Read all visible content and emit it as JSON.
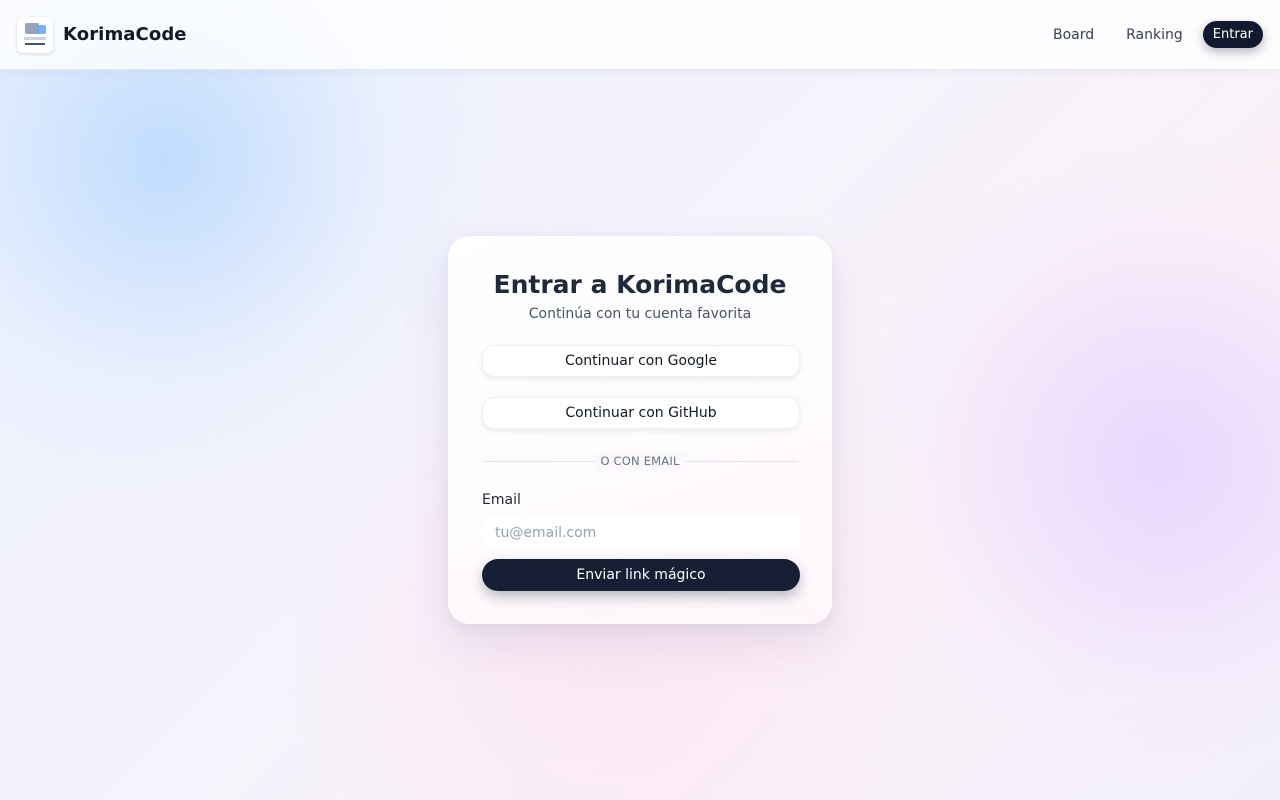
{
  "header": {
    "brand_name": "KorimaCode",
    "logo_icon": "korimacode-logo",
    "nav": {
      "board": "Board",
      "ranking": "Ranking",
      "login": "Entrar"
    }
  },
  "login_card": {
    "title": "Entrar a KorimaCode",
    "subtitle": "Continúa con tu cuenta favorita",
    "google_button": "Continuar con Google",
    "github_button": "Continuar con GitHub",
    "divider_text": "O CON EMAIL",
    "email_label": "Email",
    "email_placeholder": "tu@email.com",
    "email_value": "",
    "submit_button": "Enviar link mágico"
  },
  "colors": {
    "primary_dark": "#161f33",
    "text_dark": "#111827",
    "muted_text": "#475569"
  }
}
